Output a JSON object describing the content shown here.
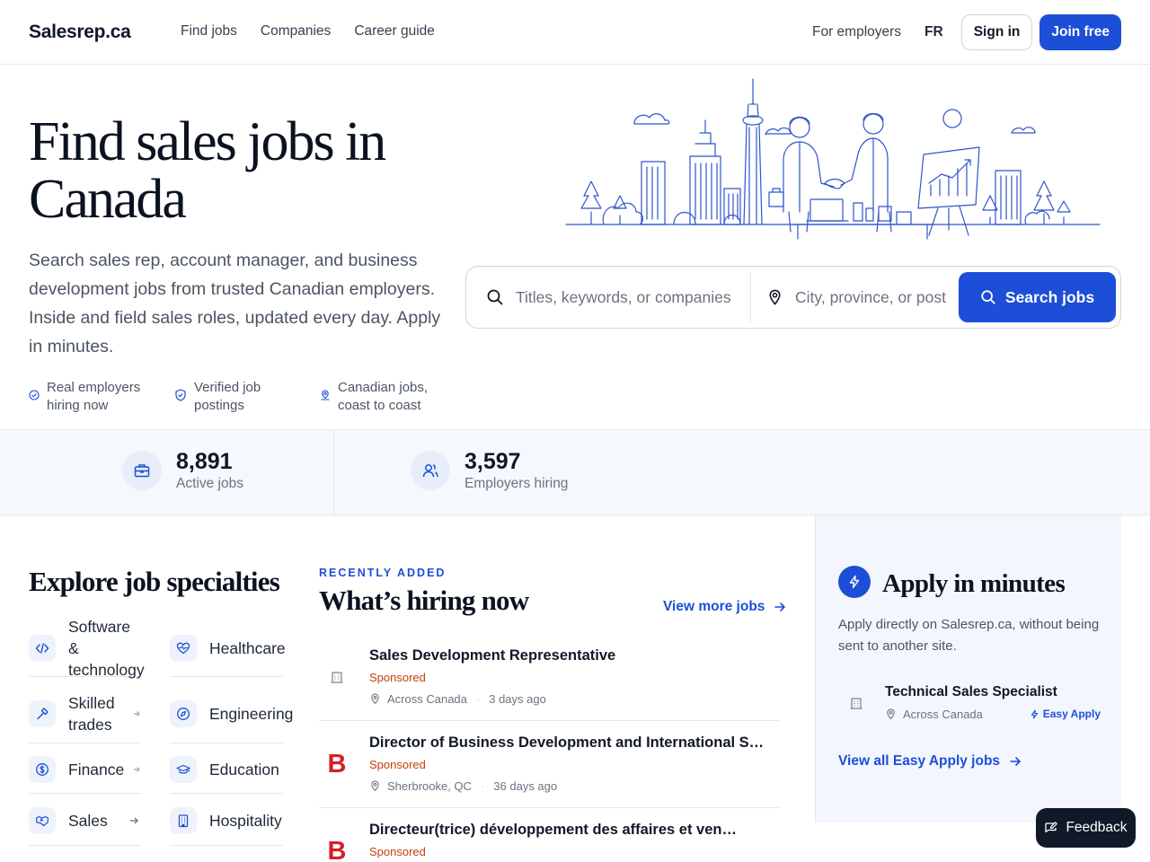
{
  "header": {
    "logo": "Salesrep.ca",
    "nav": [
      "Find jobs",
      "Companies",
      "Career guide"
    ],
    "for_employers": "For employers",
    "lang": "FR",
    "sign_in": "Sign in",
    "join": "Join free"
  },
  "hero": {
    "title_line1": "Find sales jobs in",
    "title_line2": "Canada",
    "subtitle": "Search sales rep, account manager, and business development jobs from trusted Canadian employers. Inside and field sales roles, updated every day. Apply in minutes.",
    "trust": [
      {
        "line1": "Real employers",
        "line2": "hiring now",
        "icon": "check-circle-icon"
      },
      {
        "line1": "Verified job",
        "line2": "postings",
        "icon": "shield-check-icon"
      },
      {
        "line1": "Canadian jobs,",
        "line2": "coast to coast",
        "icon": "map-pin-icon"
      }
    ]
  },
  "search": {
    "keyword_placeholder": "Titles, keywords, or companies",
    "location_placeholder": "City, province, or postal code",
    "button": "Search jobs"
  },
  "stats": [
    {
      "value": "8,891",
      "label": "Active jobs",
      "icon": "briefcase-icon"
    },
    {
      "value": "3,597",
      "label": "Employers hiring",
      "icon": "users-icon"
    }
  ],
  "specialties": {
    "title": "Explore job specialties",
    "left": [
      {
        "label_line1": "Software &",
        "label_line2": "technology",
        "icon": "code-icon"
      },
      {
        "label_line1": "Skilled",
        "label_line2": "trades",
        "icon": "hammer-icon"
      },
      {
        "label_line1": "Finance",
        "label_line2": "",
        "icon": "dollar-icon"
      },
      {
        "label_line1": "Sales",
        "label_line2": "",
        "icon": "handshake-icon"
      }
    ],
    "right": [
      {
        "label": "Healthcare",
        "icon": "heart-pulse-icon"
      },
      {
        "label": "Engineering",
        "icon": "compass-icon"
      },
      {
        "label": "Education",
        "icon": "graduation-cap-icon"
      },
      {
        "label": "Hospitality",
        "icon": "building-icon"
      }
    ]
  },
  "hiring": {
    "eyebrow": "RECENTLY ADDED",
    "title": "What’s hiring now",
    "view_more": "View more jobs",
    "jobs": [
      {
        "title": "Sales Development Representative",
        "sponsored": "Sponsored",
        "location": "Across Canada",
        "age": "3 days ago",
        "logo": "building-icon"
      },
      {
        "title": "Director of Business Development and International Sales",
        "sponsored": "Sponsored",
        "location": "Sherbrooke, QC",
        "age": "36 days ago",
        "logo": "B"
      },
      {
        "title": "Directeur(trice) développement des affaires et ventes internationales",
        "sponsored": "Sponsored",
        "location": "",
        "age": "",
        "logo": "B"
      }
    ]
  },
  "apply": {
    "title": "Apply in minutes",
    "desc": "Apply directly on Salesrep.ca, without being sent to another site.",
    "job_title": "Technical Sales Specialist",
    "job_location": "Across Canada",
    "easy_apply": "Easy Apply",
    "link": "View all Easy Apply jobs"
  },
  "feedback": "Feedback",
  "colors": {
    "accent": "#1d4ed8",
    "sponsored": "#c2410c",
    "brand_b": "#d61f26"
  }
}
